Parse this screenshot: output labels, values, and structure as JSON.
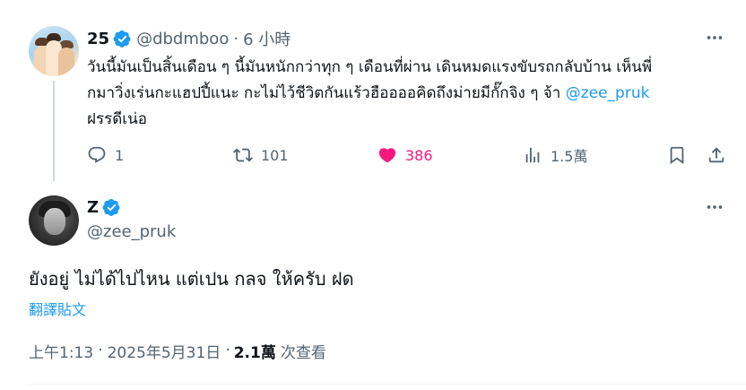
{
  "parent_tweet": {
    "display_name": "25",
    "handle": "@dbdmboo",
    "time_ago": "6 小時",
    "text_lines": [
      "วันนี้มันเป็นสิ้นเดือน ๆ นี้มันหนักกว่าทุก ๆ เดือนที่ผ่าน เดินหมดแรงขับรถกลับบ้าน เห็นพี่",
      "กมาวิ่งเร่นกะแฮปปี้แนะ กะไม่ไว้ชีวิตกันแร้วฮืออออคิดถึงม่ายมีกั๊กจิง ๆ จ้า ",
      "ฝรรดีเน่อ"
    ],
    "mention": "@zee_pruk",
    "actions": {
      "replies": "1",
      "retweets": "101",
      "likes": "386",
      "views": "1.5萬"
    },
    "accent_like": "#f91880",
    "verified_icon": "verified-badge-icon"
  },
  "main_tweet": {
    "display_name": "Z",
    "handle": "@zee_pruk",
    "text": "ยังอยู่ ไม่ได้ไปไหน แต่เปน กลจ ให้ครับ ฝด",
    "translate_label": "翻譯貼文",
    "time": "上午1:13",
    "separator": "·",
    "date": "2025年5月31日",
    "views_count": "2.1萬",
    "views_label": "次查看"
  },
  "colors": {
    "text_primary": "#0f1419",
    "text_secondary": "#536471",
    "link_blue": "#1d9bf0",
    "verified_blue": "#1d9bf0",
    "like_pink": "#f91880",
    "thread_line": "#cfd9de"
  },
  "icons": [
    "reply-icon",
    "retweet-icon",
    "like-icon",
    "views-icon",
    "bookmark-icon",
    "share-icon",
    "more-icon",
    "verified-badge-icon"
  ]
}
